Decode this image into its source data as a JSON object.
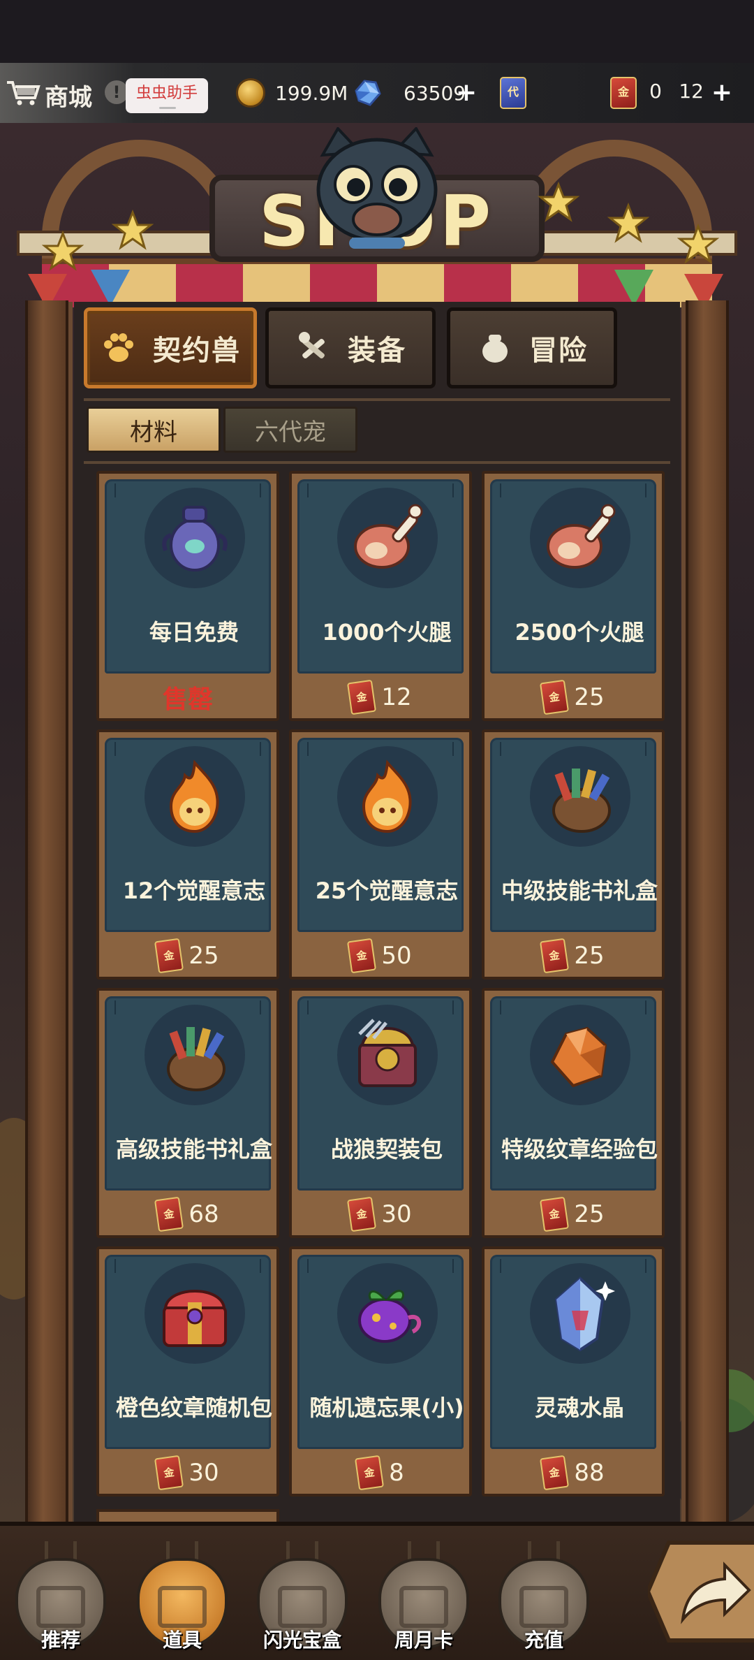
{
  "header": {
    "title": "商城",
    "warn_glyph": "!",
    "helper_badge": "虫虫助手"
  },
  "resources": {
    "gold": "199.9M",
    "gems": "63509",
    "blue_ticket": "0",
    "red_ticket": "12",
    "blue_ticket_glyph": "代",
    "red_ticket_glyph": "金"
  },
  "sign": {
    "text": "SHOP"
  },
  "main_tabs": [
    {
      "label": "契约兽",
      "icon": "paw-icon",
      "active": true
    },
    {
      "label": "装备",
      "icon": "tools-icon",
      "active": false
    },
    {
      "label": "冒险",
      "icon": "pot-icon",
      "active": false
    }
  ],
  "sub_tabs": [
    {
      "label": "材料",
      "active": true
    },
    {
      "label": "六代宠",
      "active": false
    }
  ],
  "currency_glyph": "金",
  "items": [
    {
      "name": "每日免费",
      "price": "售罄",
      "sold_out": true,
      "icon": "urn-icon"
    },
    {
      "name": "1000个火腿",
      "price": "12",
      "icon": "ham-icon"
    },
    {
      "name": "2500个火腿",
      "price": "25",
      "icon": "ham-icon"
    },
    {
      "name": "12个觉醒意志",
      "price": "25",
      "icon": "flame-icon"
    },
    {
      "name": "25个觉醒意志",
      "price": "50",
      "icon": "flame-icon"
    },
    {
      "name": "中级技能书礼盒",
      "price": "25",
      "icon": "book-sack-icon"
    },
    {
      "name": "高级技能书礼盒",
      "price": "68",
      "icon": "book-sack-icon"
    },
    {
      "name": "战狼契装包",
      "price": "30",
      "icon": "wolf-chest-icon"
    },
    {
      "name": "特级纹章经验包",
      "price": "25",
      "icon": "ore-icon"
    },
    {
      "name": "橙色纹章随机包",
      "price": "30",
      "icon": "red-chest-icon"
    },
    {
      "name": "随机遗忘果(小)",
      "price": "8",
      "icon": "fruit-icon"
    },
    {
      "name": "灵魂水晶",
      "price": "88",
      "icon": "crystal-icon"
    }
  ],
  "bottom_nav": [
    {
      "label": "推荐",
      "active": false
    },
    {
      "label": "道具",
      "active": true
    },
    {
      "label": "闪光宝盒",
      "active": false
    },
    {
      "label": "周月卡",
      "active": false
    },
    {
      "label": "充值",
      "active": false
    }
  ],
  "colors": {
    "accent_orange": "#c87a2c",
    "panel_teal": "#2f4a58",
    "sold_red": "#e0362b",
    "card_wood": "#8a6340"
  }
}
